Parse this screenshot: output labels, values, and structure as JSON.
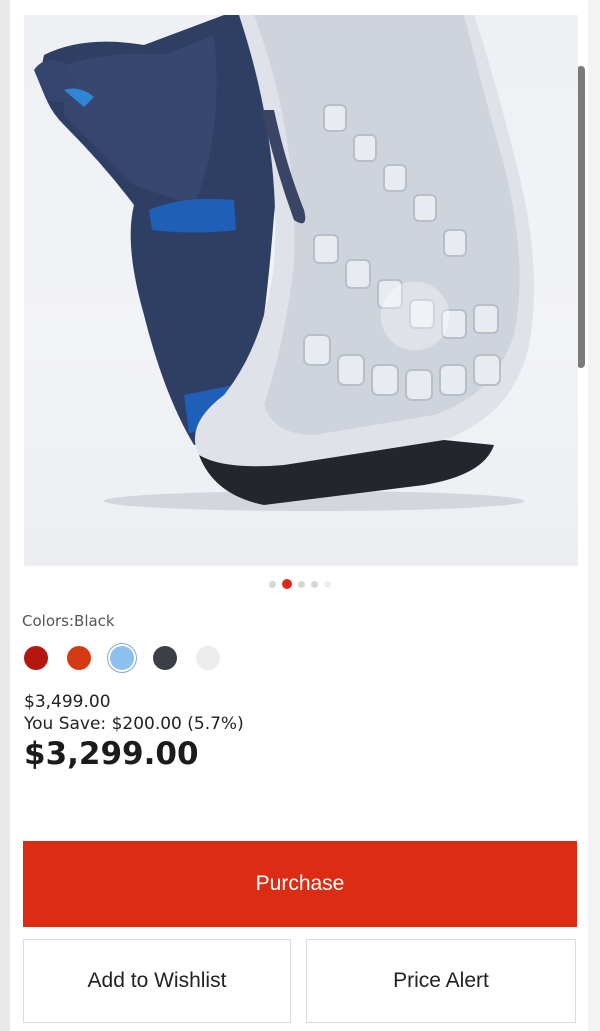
{
  "product": {
    "image_alt": "Blue mesh running shoe, sole view",
    "carousel": {
      "count": 5,
      "active_index": 1
    }
  },
  "colors": {
    "label": "Colors:Black",
    "swatches": [
      {
        "name": "red",
        "hex": "#b5160f",
        "selected": false
      },
      {
        "name": "orange",
        "hex": "#d63a14",
        "selected": false
      },
      {
        "name": "light-blue",
        "hex": "#8cc0ef",
        "selected": true
      },
      {
        "name": "charcoal",
        "hex": "#3c3f44",
        "selected": false
      },
      {
        "name": "white",
        "hex": "#ececec",
        "selected": false
      }
    ]
  },
  "pricing": {
    "original": "$3,499.00",
    "savings": "You Save: $200.00 (5.7%)",
    "final": "$3,299.00"
  },
  "actions": {
    "purchase": "Purchase",
    "wishlist": "Add to Wishlist",
    "price_alert": "Price Alert"
  },
  "theme": {
    "accent": "#dc2c14"
  }
}
